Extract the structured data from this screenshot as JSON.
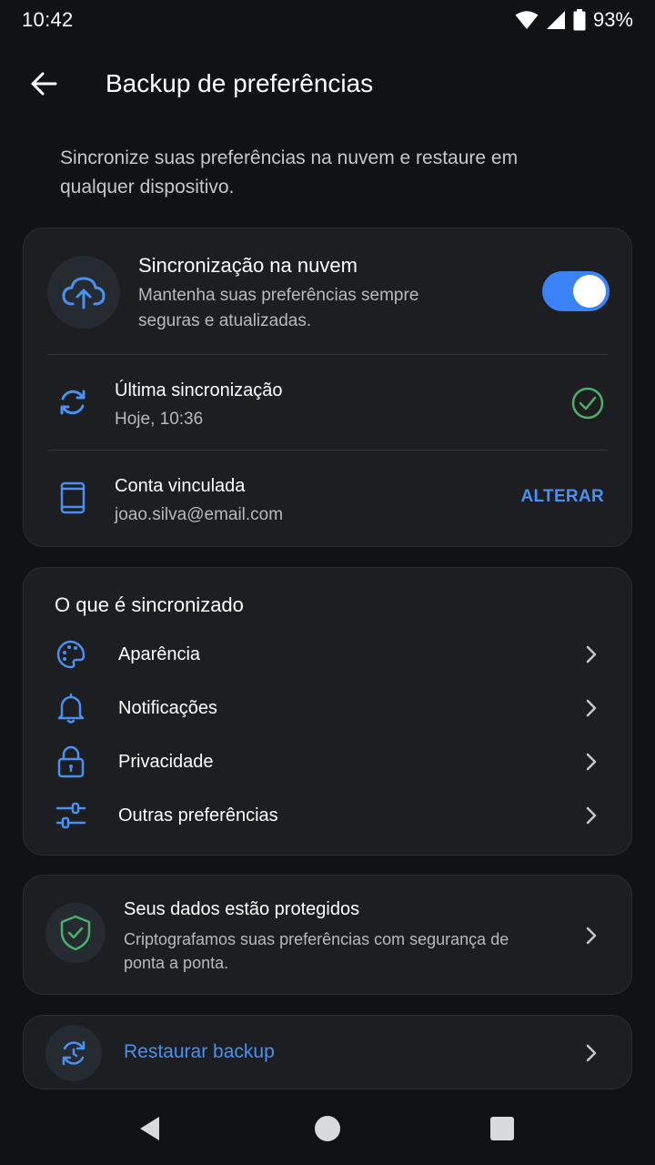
{
  "status_bar": {
    "time": "10:42",
    "battery": "93%"
  },
  "app_bar": {
    "title": "Backup de preferências"
  },
  "intro": "Sincronize suas preferências na nuvem e restaure em qualquer dispositivo.",
  "cloud_sync": {
    "title": "Sincronização na nuvem",
    "subtitle": "Mantenha suas preferências sempre seguras e atualizadas.",
    "enabled": true
  },
  "last_sync": {
    "title": "Última sincronização",
    "value": "Hoje, 10:36"
  },
  "linked_account": {
    "title": "Conta vinculada",
    "email": "joao.silva@email.com",
    "action": "ALTERAR"
  },
  "synced_items": {
    "header": "O que é sincronizado",
    "items": [
      {
        "label": "Aparência",
        "icon": "palette-icon"
      },
      {
        "label": "Notificações",
        "icon": "bell-icon"
      },
      {
        "label": "Privacidade",
        "icon": "lock-icon"
      },
      {
        "label": "Outras preferências",
        "icon": "sliders-icon"
      }
    ]
  },
  "protection": {
    "title": "Seus dados estão protegidos",
    "subtitle": "Criptografamos suas preferências com segurança de ponta a ponta."
  },
  "restore": {
    "label": "Restaurar backup"
  },
  "colors": {
    "accent": "#3b82f6",
    "link": "#4a90f0",
    "success": "#4caf6a",
    "card": "#1c1e21",
    "background": "#111213"
  }
}
